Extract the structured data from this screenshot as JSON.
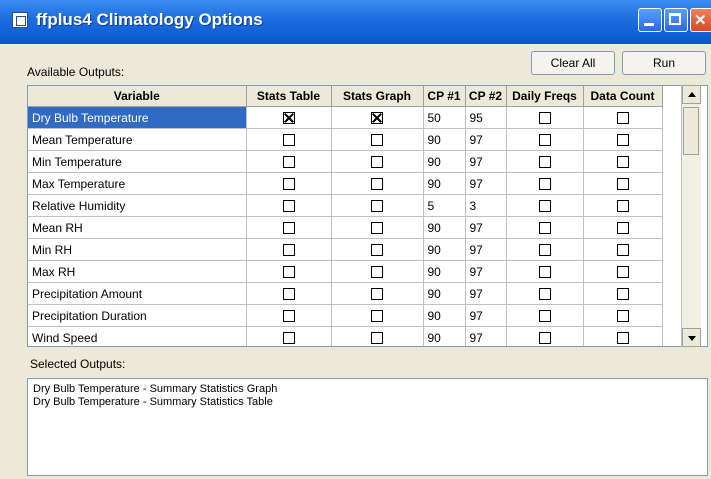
{
  "window": {
    "title": "ffplus4 Climatology Options"
  },
  "labels": {
    "available_outputs": "Available Outputs:",
    "selected_outputs": "Selected Outputs:"
  },
  "buttons": {
    "clear_all": "Clear All",
    "run": "Run"
  },
  "table": {
    "columns": [
      "Variable",
      "Stats Table",
      "Stats Graph",
      "CP #1",
      "CP #2",
      "Daily Freqs",
      "Data Count"
    ],
    "rows": [
      {
        "variable": "Dry Bulb Temperature",
        "stats_table": true,
        "stats_graph": true,
        "cp1": "50",
        "cp2": "95",
        "daily_freqs": false,
        "data_count": false,
        "selected": true
      },
      {
        "variable": "Mean Temperature",
        "stats_table": false,
        "stats_graph": false,
        "cp1": "90",
        "cp2": "97",
        "daily_freqs": false,
        "data_count": false
      },
      {
        "variable": "Min Temperature",
        "stats_table": false,
        "stats_graph": false,
        "cp1": "90",
        "cp2": "97",
        "daily_freqs": false,
        "data_count": false
      },
      {
        "variable": "Max Temperature",
        "stats_table": false,
        "stats_graph": false,
        "cp1": "90",
        "cp2": "97",
        "daily_freqs": false,
        "data_count": false
      },
      {
        "variable": "Relative Humidity",
        "stats_table": false,
        "stats_graph": false,
        "cp1": "5",
        "cp2": "3",
        "daily_freqs": false,
        "data_count": false
      },
      {
        "variable": "Mean RH",
        "stats_table": false,
        "stats_graph": false,
        "cp1": "90",
        "cp2": "97",
        "daily_freqs": false,
        "data_count": false
      },
      {
        "variable": "Min RH",
        "stats_table": false,
        "stats_graph": false,
        "cp1": "90",
        "cp2": "97",
        "daily_freqs": false,
        "data_count": false
      },
      {
        "variable": "Max RH",
        "stats_table": false,
        "stats_graph": false,
        "cp1": "90",
        "cp2": "97",
        "daily_freqs": false,
        "data_count": false
      },
      {
        "variable": "Precipitation Amount",
        "stats_table": false,
        "stats_graph": false,
        "cp1": "90",
        "cp2": "97",
        "daily_freqs": false,
        "data_count": false
      },
      {
        "variable": "Precipitation Duration",
        "stats_table": false,
        "stats_graph": false,
        "cp1": "90",
        "cp2": "97",
        "daily_freqs": false,
        "data_count": false
      },
      {
        "variable": "Wind Speed",
        "stats_table": false,
        "stats_graph": false,
        "cp1": "90",
        "cp2": "97",
        "daily_freqs": false,
        "data_count": false
      }
    ]
  },
  "selected_outputs": [
    "Dry Bulb Temperature - Summary Statistics Graph",
    "Dry Bulb Temperature - Summary Statistics Table"
  ],
  "colors": {
    "title_bar": "#0a56d0",
    "selection": "#316ac5",
    "window_bg": "#ece9d8"
  }
}
